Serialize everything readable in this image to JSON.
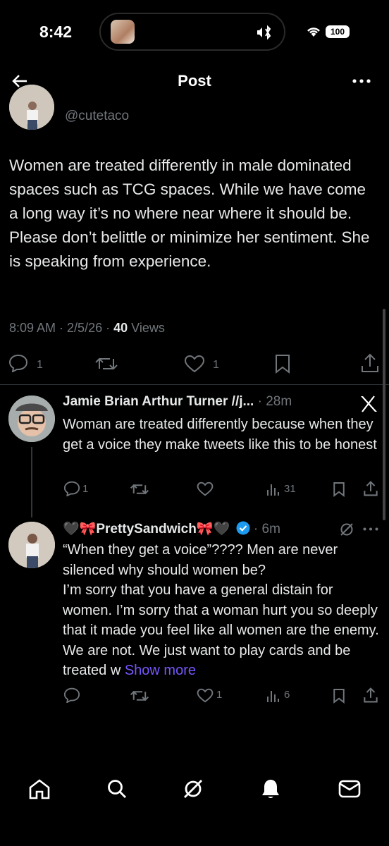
{
  "status_bar": {
    "time": "8:42",
    "battery": "100"
  },
  "header": {
    "title": "Post"
  },
  "post": {
    "handle": "@cutetaco",
    "text": "Women are treated differently in male dominated spaces such as TCG spaces. While we have come a long way it’s no where near where it should be. Please don’t belittle or minimize her sentiment. She is speaking from experience.",
    "time": "8:09 AM",
    "date": "2/5/26",
    "views_count": "40",
    "views_label": "Views",
    "replies": "1",
    "likes": "1"
  },
  "replies": [
    {
      "name": "Jamie Brian Arthur Turner //j...",
      "time": "28m",
      "text": "Woman are treated differently because when they get a voice they make tweets like this to be honest",
      "replies": "1",
      "views": "31"
    },
    {
      "name": "🖤🎀PrettySandwich🎀🖤",
      "time": "6m",
      "text": "“When they get a voice”???? Men are never silenced why should women be?\nI’m sorry that you have a general distain for women. I’m sorry that a woman hurt you so deeply that it made you feel like all women are the enemy. We are not. We just want to play cards and be treated w",
      "show_more": "Show more",
      "likes": "1",
      "views": "6"
    }
  ],
  "colors": {
    "accent": "#7856ff",
    "verified": "#1d9bf0",
    "muted": "#71767b"
  }
}
